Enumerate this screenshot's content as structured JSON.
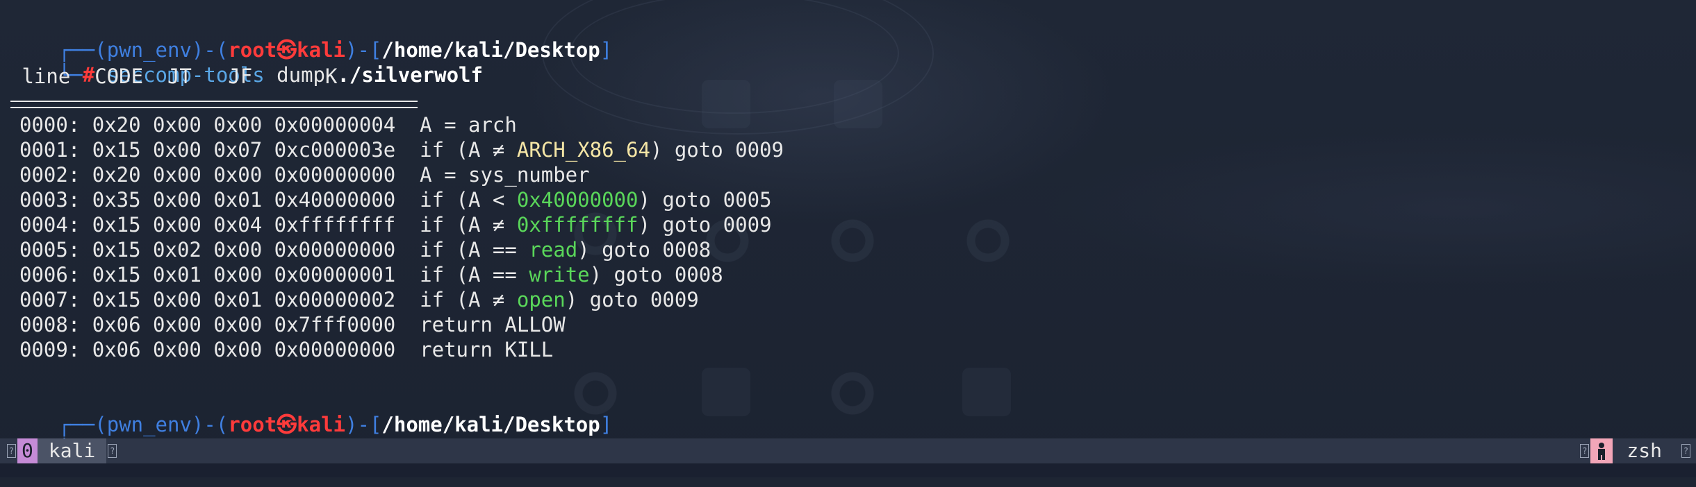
{
  "prompt1": {
    "box_top": "┌──",
    "env": "(pwn_env)",
    "dash": "-",
    "open_paren": "(",
    "user": "root",
    "skull": "㉿",
    "host": "kali",
    "close_paren": ")",
    "dash2": "-",
    "open_bracket": "[",
    "cwd": "/home/kali/Desktop",
    "close_bracket": "]",
    "box_bottom": "└─",
    "hash": "#",
    "command": "seccomp-tools",
    "args": " dump ",
    "target": "./silverwolf"
  },
  "table_header": " line  CODE  JT   JF      K",
  "rows": [
    {
      "addr": "0000: 0x20 0x00 0x00 0x00000004  ",
      "pre": "A = arch",
      "hl": "",
      "post": "",
      "hl_color": "plain"
    },
    {
      "addr": "0001: 0x15 0x00 0x07 0xc000003e  ",
      "pre": "if (A ≠ ",
      "hl": "ARCH_X86_64",
      "post": ") goto 0009",
      "hl_color": "yellow"
    },
    {
      "addr": "0002: 0x20 0x00 0x00 0x00000000  ",
      "pre": "A = sys_number",
      "hl": "",
      "post": "",
      "hl_color": "plain"
    },
    {
      "addr": "0003: 0x35 0x00 0x01 0x40000000  ",
      "pre": "if (A < ",
      "hl": "0x40000000",
      "post": ") goto 0005",
      "hl_color": "green"
    },
    {
      "addr": "0004: 0x15 0x00 0x04 0xffffffff  ",
      "pre": "if (A ≠ ",
      "hl": "0xffffffff",
      "post": ") goto 0009",
      "hl_color": "green"
    },
    {
      "addr": "0005: 0x15 0x02 0x00 0x00000000  ",
      "pre": "if (A == ",
      "hl": "read",
      "post": ") goto 0008",
      "hl_color": "green"
    },
    {
      "addr": "0006: 0x15 0x01 0x00 0x00000001  ",
      "pre": "if (A == ",
      "hl": "write",
      "post": ") goto 0008",
      "hl_color": "green"
    },
    {
      "addr": "0007: 0x15 0x00 0x01 0x00000002  ",
      "pre": "if (A ≠ ",
      "hl": "open",
      "post": ") goto 0009",
      "hl_color": "green"
    },
    {
      "addr": "0008: 0x06 0x00 0x00 0x7fff0000  ",
      "pre": "return ALLOW",
      "hl": "",
      "post": "",
      "hl_color": "plain"
    },
    {
      "addr": "0009: 0x06 0x00 0x00 0x00000000  ",
      "pre": "return KILL",
      "hl": "",
      "post": "",
      "hl_color": "plain"
    }
  ],
  "prompt2": {
    "box_top": "┌──",
    "env": "(pwn_env)",
    "dash": "-",
    "open_paren": "(",
    "user": "root",
    "skull": "㉿",
    "host": "kali",
    "close_paren": ")",
    "dash2": "-",
    "open_bracket": "[",
    "cwd": "/home/kali/Desktop",
    "close_bracket": "]",
    "box_bottom": "└─",
    "hash": "#"
  },
  "statusbar": {
    "left_sep": "?",
    "window_index": "0",
    "window_name": "kali",
    "left_end": "?",
    "right_sep": "?",
    "shell_icon": "person-icon",
    "shell_name": "zsh",
    "right_end": "?"
  },
  "colors": {
    "background": "#1e2533",
    "prompt_blue": "#3f7fe0",
    "prompt_red": "#ff3b3b",
    "command_blue": "#5aa7e6",
    "syscall_green": "#5ad75a",
    "arch_yellow": "#f5e6a6",
    "status_bg": "#2e3648",
    "window_index_bg": "#c58bd6",
    "shell_badge_bg": "#f2a6b8"
  }
}
